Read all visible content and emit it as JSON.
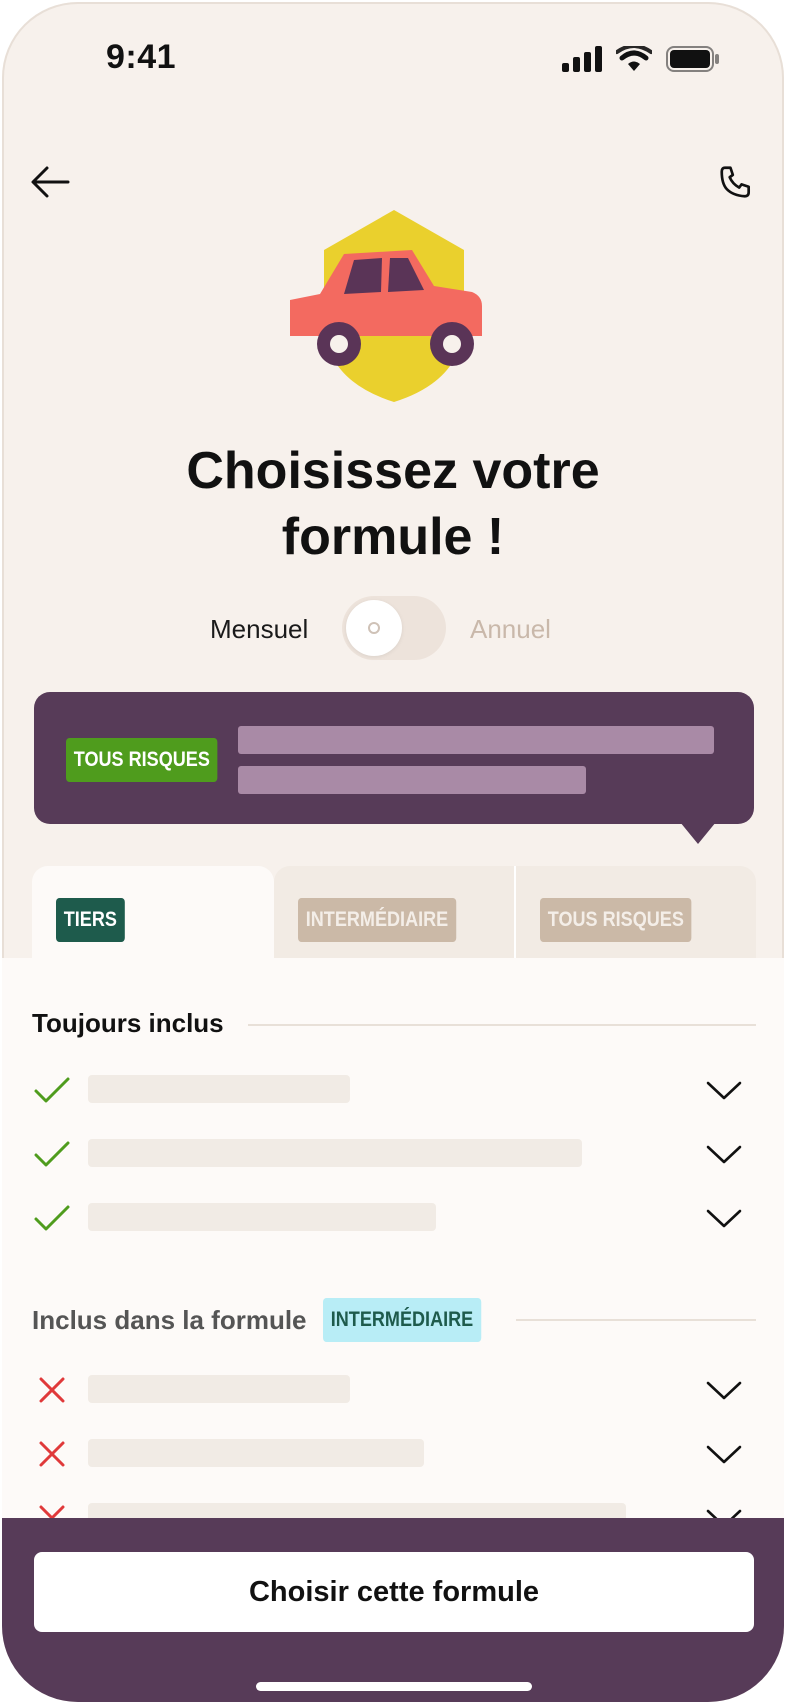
{
  "status_bar": {
    "time": "9:41"
  },
  "header": {
    "back_icon": "arrow-left-icon",
    "call_icon": "phone-icon"
  },
  "title": {
    "line1": "Choisissez votre",
    "line2": "formule !"
  },
  "billing_toggle": {
    "left_label": "Mensuel",
    "right_label": "Annuel",
    "selected": "Mensuel"
  },
  "selected_plan_card": {
    "badge": "TOUS RISQUES"
  },
  "tabs": [
    {
      "label": "TIERS",
      "active": true
    },
    {
      "label": "INTERMÉDIAIRE",
      "active": false
    },
    {
      "label": "TOUS RISQUES",
      "active": false
    }
  ],
  "sections": {
    "always_included": {
      "heading": "Toujours inclus",
      "status_icon": "check-icon"
    },
    "included_in_plan": {
      "heading": "Inclus dans la formule",
      "badge": "INTERMÉDIAIRE",
      "status_icon": "cross-icon"
    }
  },
  "cta": {
    "label": "Choisir cette formule"
  },
  "colors": {
    "background": "#f7f1ec",
    "brand_purple": "#573b58",
    "green": "#4f9c1d",
    "teal": "#1e5b4c",
    "cyan": "#b8edf6",
    "error_red": "#e0393a"
  }
}
